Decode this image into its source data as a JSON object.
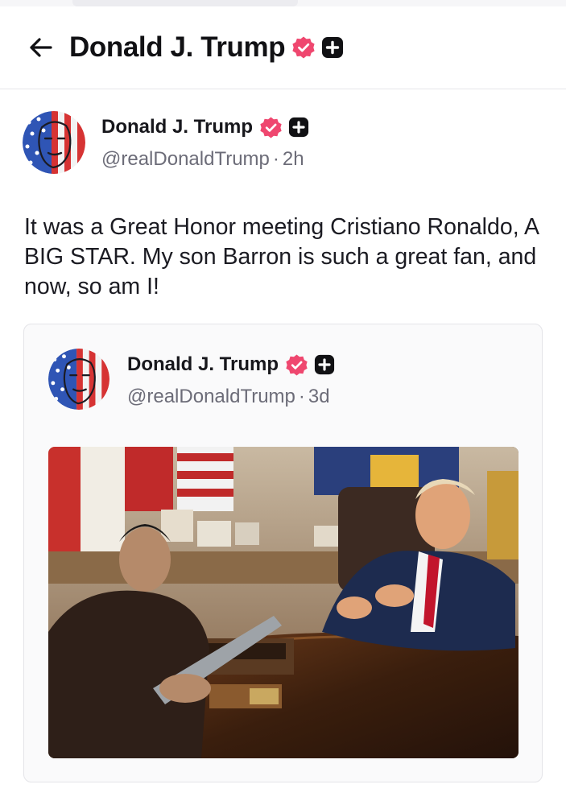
{
  "header": {
    "title": "Donald J. Trump",
    "back_icon": "arrow-left-icon",
    "verified_icon": "verified-badge-icon",
    "plus_icon": "plus-badge-icon"
  },
  "post": {
    "author_name": "Donald J. Trump",
    "handle": "@realDonaldTrump",
    "separator": "·",
    "time": "2h",
    "text": "It was a Great Honor meeting Cristiano Ronaldo, A BIG STAR. My son Barron is such a great fan, and now, so am I!"
  },
  "quote": {
    "author_name": "Donald J. Trump",
    "handle": "@realDonaldTrump",
    "separator": "·",
    "time": "3d"
  },
  "colors": {
    "verified": "#ef476f",
    "plus_badge": "#111114",
    "text_primary": "#17171c",
    "text_secondary": "#6c6c78",
    "divider": "#e6e6ea"
  }
}
